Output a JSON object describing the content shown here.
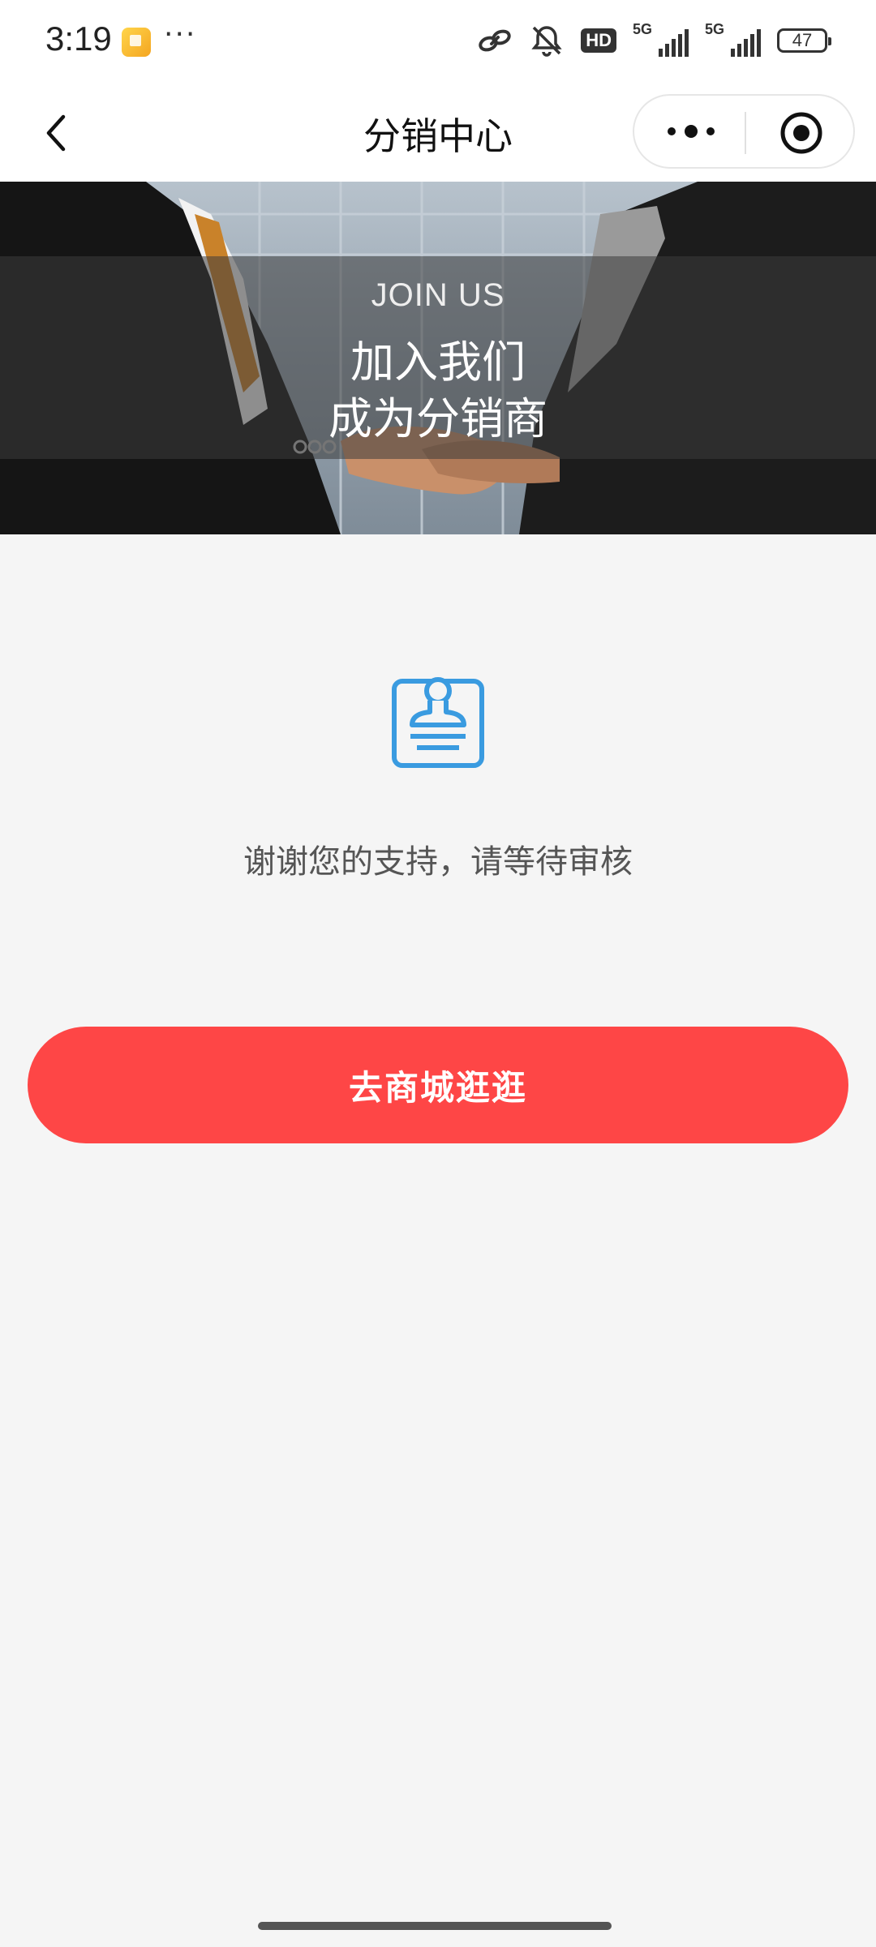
{
  "status_bar": {
    "time": "3:19",
    "more": "···",
    "hd_label": "HD",
    "network_1": "5G",
    "network_2": "5G",
    "battery": "47"
  },
  "nav": {
    "title": "分销中心",
    "back_icon": "chevron-left-icon",
    "more_icon": "more-dots-icon",
    "close_icon": "target-circle-icon"
  },
  "banner": {
    "subtitle": "JOIN US",
    "line1": "加入我们",
    "line2": "成为分销商"
  },
  "status": {
    "icon": "stamp-clipboard-icon",
    "message": "谢谢您的支持，请等待审核"
  },
  "actions": {
    "shop_button": "去商城逛逛"
  },
  "colors": {
    "accent": "#fe4646",
    "icon_blue": "#3a9be0",
    "background": "#f5f5f5"
  }
}
